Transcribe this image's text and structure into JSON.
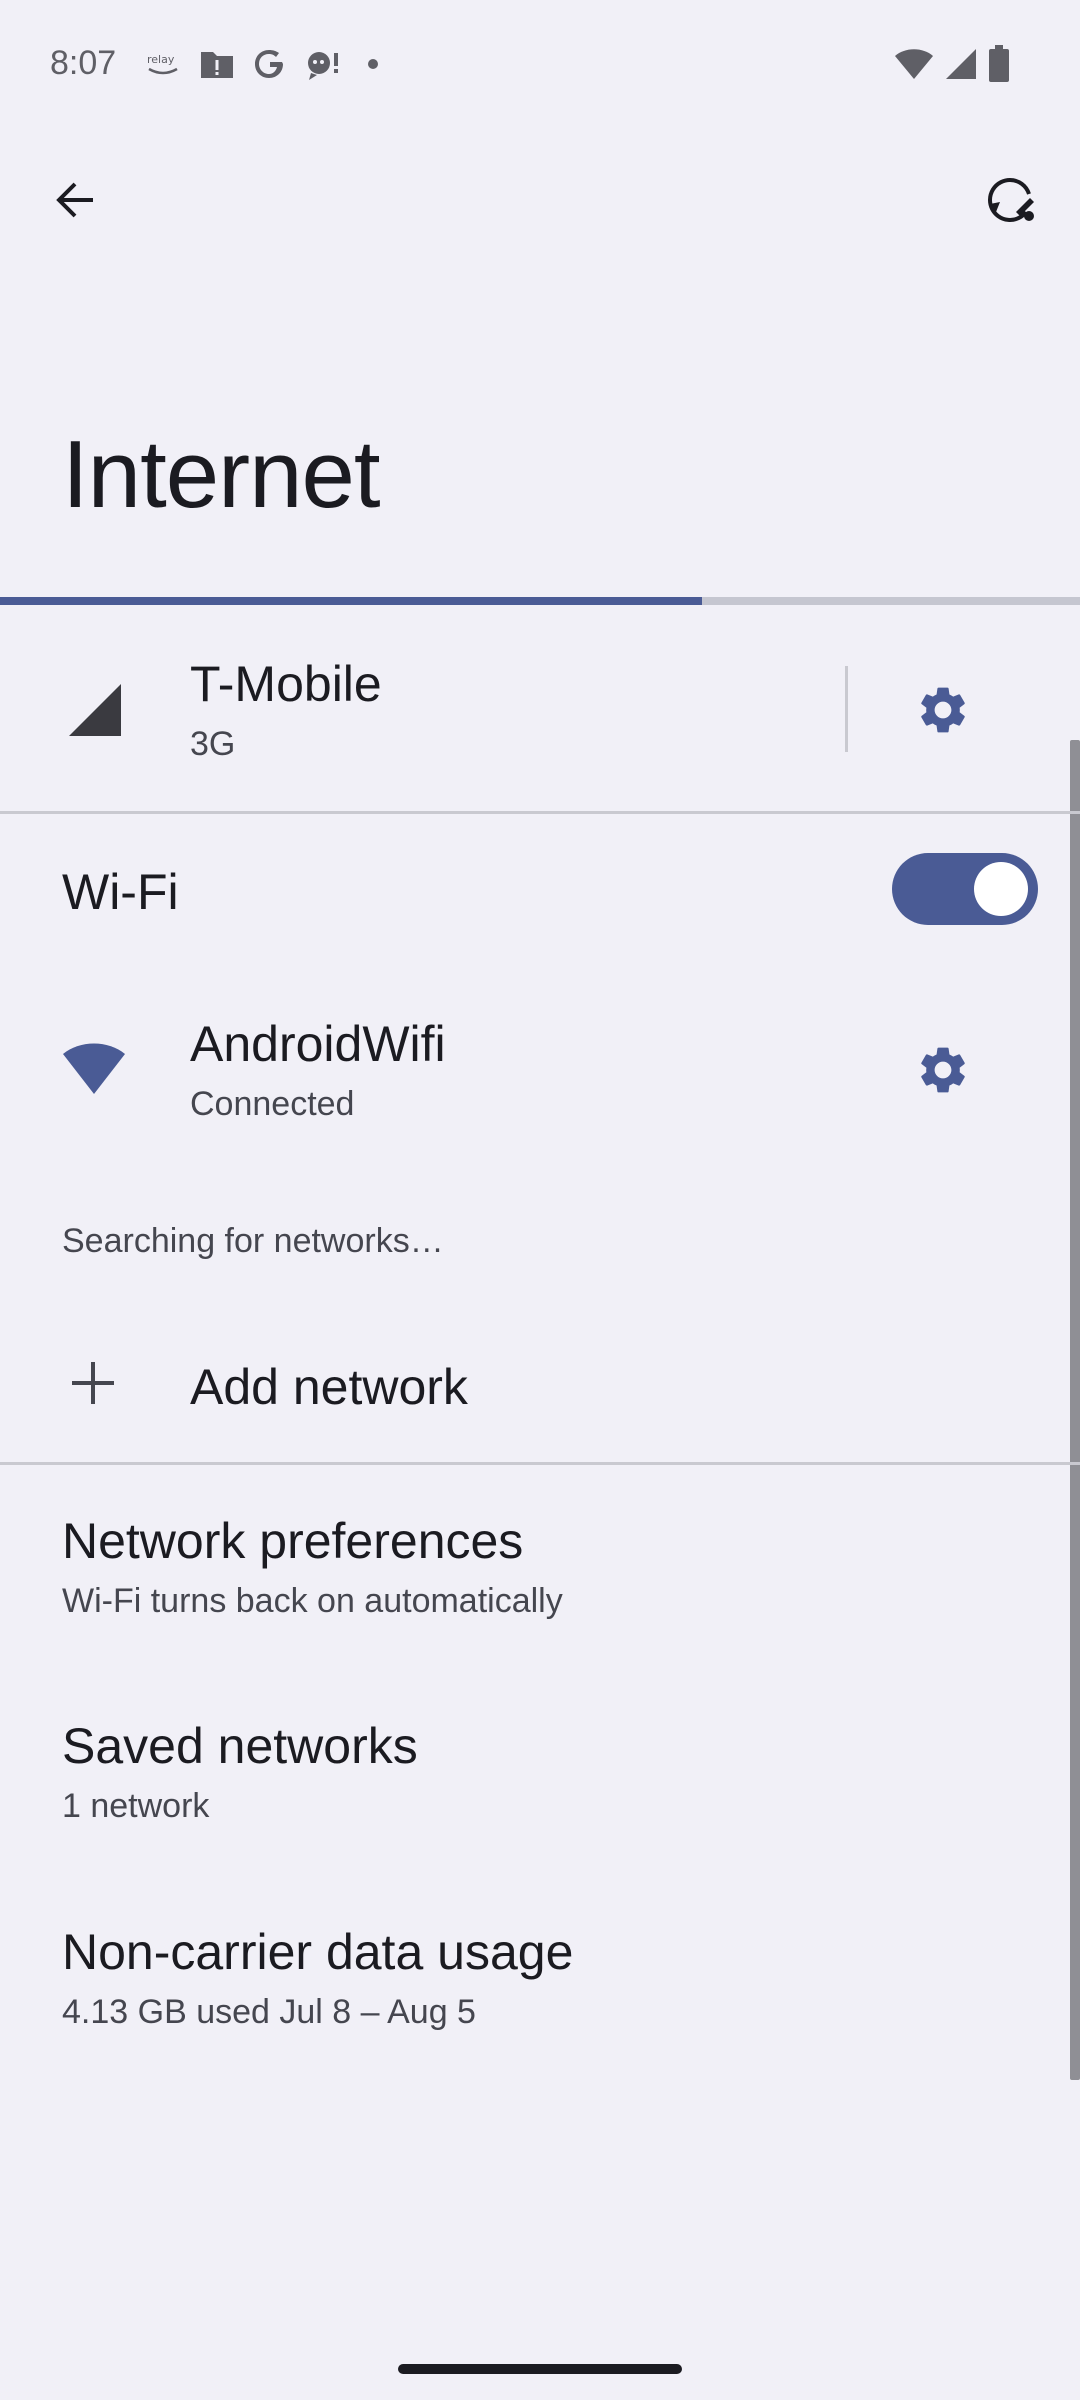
{
  "status_bar": {
    "time": "8:07",
    "left_icons": [
      "relay-icon",
      "folder-alert-icon",
      "google-icon",
      "assistant-icon",
      "dot-icon"
    ],
    "right_icons": [
      "wifi-icon",
      "cell-signal-icon",
      "battery-icon"
    ]
  },
  "app_bar": {
    "back_icon": "arrow-back-icon",
    "action_icon": "reset-network-icon"
  },
  "page": {
    "title": "Internet",
    "progress_fraction": 0.65
  },
  "mobile": {
    "carrier": "T-Mobile",
    "network_type": "3G",
    "icon": "cell-signal-icon",
    "settings_icon": "gear-icon"
  },
  "wifi": {
    "label": "Wi-Fi",
    "enabled": true
  },
  "connected_network": {
    "name": "AndroidWifi",
    "status": "Connected",
    "icon": "wifi-icon",
    "settings_icon": "gear-icon"
  },
  "searching_text": "Searching for networks…",
  "add_network": {
    "label": "Add network",
    "icon": "plus-icon"
  },
  "network_preferences": {
    "title": "Network preferences",
    "summary": "Wi-Fi turns back on automatically"
  },
  "saved_networks": {
    "title": "Saved networks",
    "summary": "1 network"
  },
  "data_usage": {
    "title": "Non-carrier data usage",
    "summary": "4.13 GB used Jul 8 – Aug 5"
  },
  "colors": {
    "accent": "#4a5b95",
    "background": "#f1f0f7",
    "text_primary": "#1b1b21",
    "text_secondary": "#45464f"
  }
}
